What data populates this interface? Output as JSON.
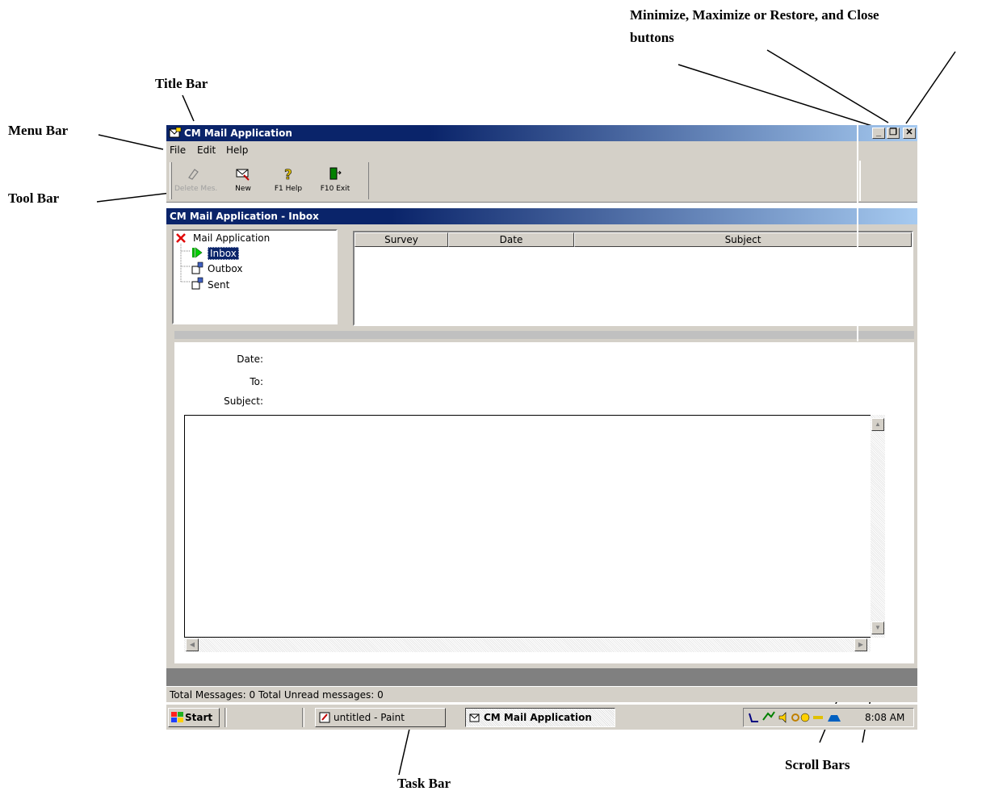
{
  "annotations": {
    "minimize_line1": "Minimize, Maximize or Restore, and Close",
    "minimize_line2": "buttons",
    "title_bar": "Title Bar",
    "menu_bar": "Menu Bar",
    "tool_bar": "Tool Bar",
    "scroll_bars": "Scroll Bars",
    "task_bar": "Task Bar"
  },
  "window": {
    "title": "CM Mail Application",
    "buttons": {
      "minimize": "_",
      "restore": "❐",
      "close": "✕"
    }
  },
  "menu": [
    "File",
    "Edit",
    "Help"
  ],
  "toolbar": [
    {
      "label": "Delete Mes.",
      "icon": "eraser-icon",
      "enabled": false
    },
    {
      "label": "New",
      "icon": "new-message-icon",
      "enabled": true
    },
    {
      "label": "F1 Help",
      "icon": "help-question-icon",
      "enabled": true
    },
    {
      "label": "F10 Exit",
      "icon": "exit-door-icon",
      "enabled": true
    }
  ],
  "inner_window": {
    "title": "CM Mail Application - Inbox"
  },
  "tree": {
    "root": "Mail Application",
    "items": [
      "Inbox",
      "Outbox",
      "Sent"
    ],
    "selected": "Inbox"
  },
  "list_columns": [
    "Survey",
    "Date",
    "Subject"
  ],
  "message_fields": {
    "date": "Date:",
    "to": "To:",
    "subject": "Subject:"
  },
  "status_bar": "Total Messages: 0 Total Unread messages: 0",
  "taskbar": {
    "start": "Start",
    "tasks": [
      "untitled - Paint",
      "CM Mail Application"
    ],
    "active_task": "CM Mail Application",
    "clock": "8:08 AM"
  },
  "colors": {
    "title_active": "#0a246a",
    "title_gradient_end": "#a6caf0",
    "face": "#d4d0c8"
  }
}
